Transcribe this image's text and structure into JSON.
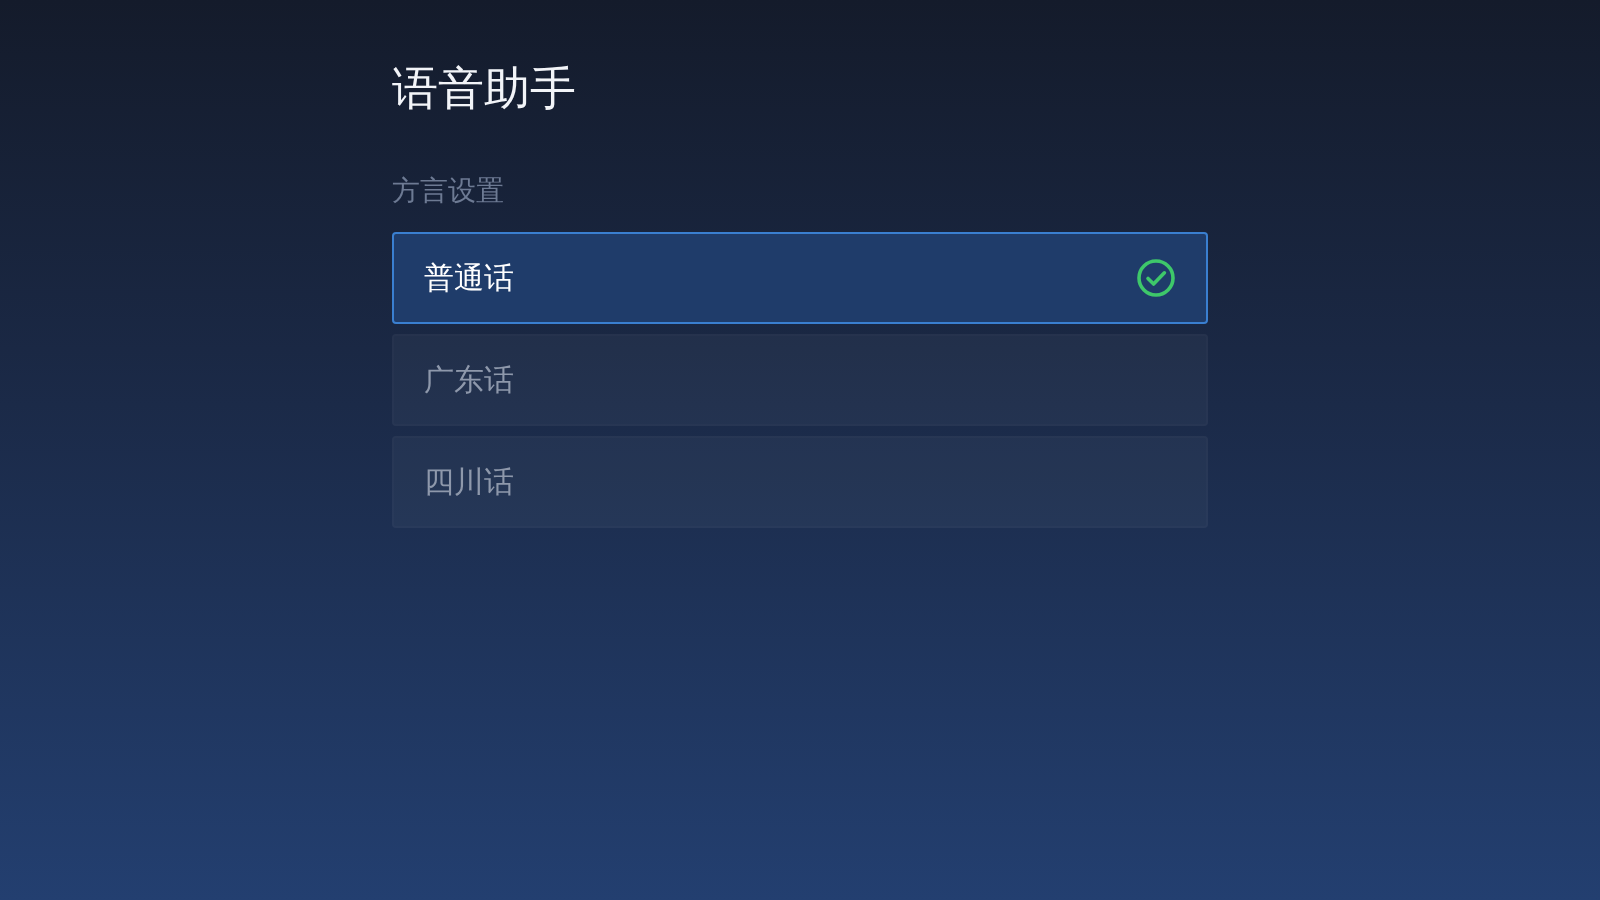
{
  "title": "语音助手",
  "section": {
    "label": "方言设置",
    "options": [
      {
        "label": "普通话",
        "selected": true
      },
      {
        "label": "广东话",
        "selected": false
      },
      {
        "label": "四川话",
        "selected": false
      }
    ]
  }
}
